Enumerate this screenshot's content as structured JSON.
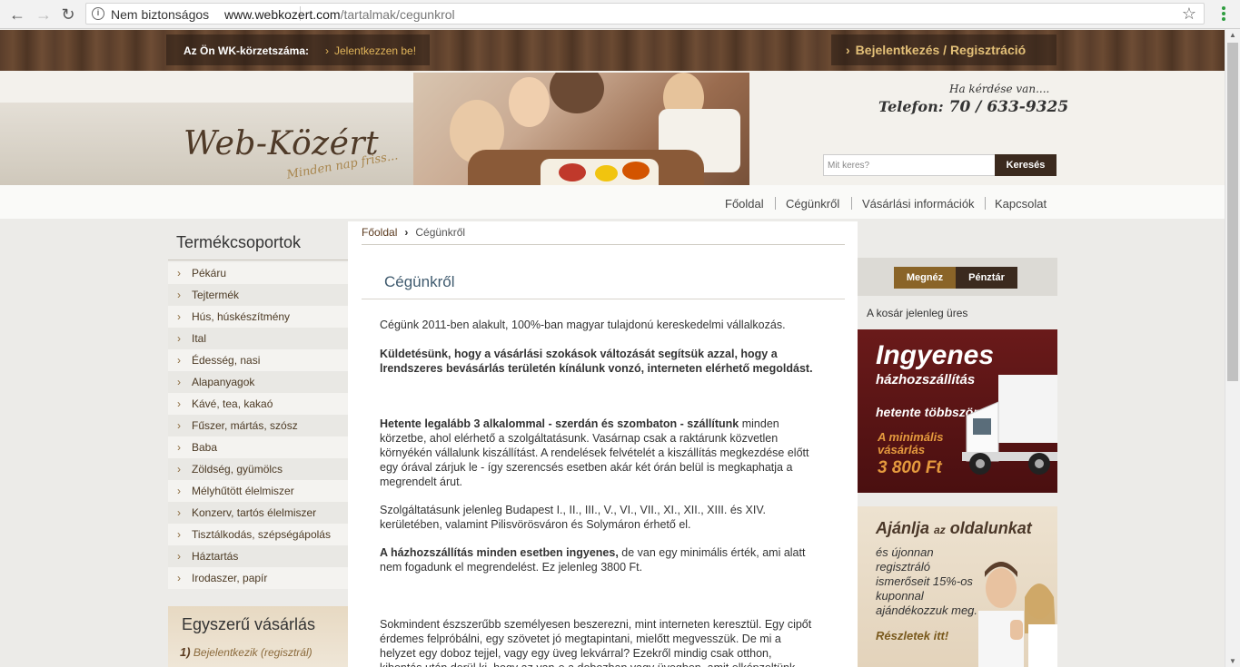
{
  "browser": {
    "security_label": "Nem biztonságos",
    "url_host": "www.webkozert.com",
    "url_path": "/tartalmak/cegunkrol"
  },
  "topbar": {
    "zip_label": "Az Ön WK-körzetszáma:",
    "zip_link": "Jelentkezzen be!",
    "login_button": "Bejelentkezés / Regisztráció"
  },
  "header": {
    "logo_title": "Web-Közért",
    "logo_slogan": "Minden nap friss...",
    "help_question": "Ha kérdése van....",
    "phone_label": "Telefon:",
    "phone_number": "70 / 633-9325",
    "search_placeholder": "Mit keres?",
    "search_button": "Keresés"
  },
  "main_nav": [
    "Főoldal",
    "Cégünkről",
    "Vásárlási információk",
    "Kapcsolat"
  ],
  "sidebar": {
    "title": "Termékcsoportok",
    "categories": [
      "Pékáru",
      "Tejtermék",
      "Hús, húskészítmény",
      "Ital",
      "Édesség, nasi",
      "Alapanyagok",
      "Kávé, tea, kakaó",
      "Fűszer, mártás, szósz",
      "Baba",
      "Zöldség, gyümölcs",
      "Mélyhűtött élelmiszer",
      "Konzerv, tartós élelmiszer",
      "Tisztálkodás, szépségápolás",
      "Háztartás",
      "Irodaszer, papír"
    ],
    "easy_title": "Egyszerű vásárlás",
    "easy_step_num": "1)",
    "easy_step_text": "Bejelentkezik (regisztrál)"
  },
  "content": {
    "breadcrumb_home": "Főoldal",
    "breadcrumb_current": "Cégünkről",
    "title": "Cégünkről",
    "p1": "Cégünk 2011-ben alakult, 100%-ban magyar tulajdonú kereskedelmi vállalkozás.",
    "p2": "Küldetésünk, hogy a vásárlási szokások változását segítsük azzal, hogy a lrendszeres bevásárlás területén kínálunk vonzó, interneten elérhető megoldást.",
    "p3_bold": "Hetente legalább 3 alkalommal - szerdán és szombaton - szállítunk",
    "p3_rest": " minden körzetbe, ahol elérhető a szolgáltatásunk. Vasárnap csak a raktárunk közvetlen környékén vállalunk kiszállítást. A rendelések felvételét a kiszállítás megkezdése előtt egy órával zárjuk le - így szerencsés esetben akár két órán belül is megkaphatja a megrendelt árut.",
    "p4": "Szolgáltatásunk jelenleg Budapest I., II., III., V., VI., VII., XI., XII., XIII. és XIV. kerületében, valamint Pilisvörösváron és Solymáron érhető el.",
    "p5_bold": "A házhozszállítás minden esetben ingyenes,",
    "p5_rest": " de van egy minimális érték, ami alatt nem fogadunk el megrendelést. Ez jelenleg 3800 Ft.",
    "p6": "Sokmindent észszerűbb személyesen beszerezni, mint interneten keresztül. Egy cipőt érdemes felpróbálni, egy szövetet jó megtapintani, mielőtt megvesszük. De mi a helyzet egy doboz tejjel, vagy egy üveg lekvárral? Ezekről mindig csak otthon, kibontás után derül ki, hogy az van-e a dobozban vagy üvegben, amit elképzeltünk"
  },
  "cart": {
    "view_button": "Megnéz",
    "checkout_button": "Pénztár",
    "empty_text": "A kosár jelenleg üres"
  },
  "promo": {
    "big": "Ingyenes",
    "sub": "házhozszállítás",
    "freq": "hetente többször",
    "min_label": "A minimális vásárlás",
    "price": "3 800 Ft"
  },
  "referral": {
    "title_main": "Ajánlja",
    "title_small": "az",
    "title_end": "oldalunkat",
    "text": "és újonnan regisztráló ismerőseit 15%-os kuponnal ajándékozzuk meg.",
    "link": "Részletek itt!"
  },
  "colors": {
    "brand_brown": "#3b2a1e",
    "accent_gold": "#8a6428",
    "promo_red": "#6a1a1a",
    "link_gold": "#e0b45a"
  }
}
